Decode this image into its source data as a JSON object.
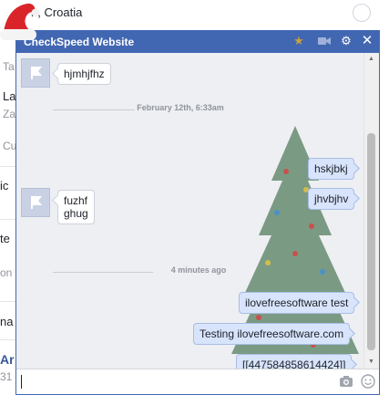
{
  "background": {
    "top_location": "h, Croatia",
    "fragments": [
      "Ta",
      "La",
      "Za",
      "Cu",
      "ic",
      "te",
      "on",
      "na",
      "Ar",
      "31"
    ]
  },
  "chat": {
    "title": "CheckSpeed Website",
    "header_icons": [
      "star-icon",
      "video-call-icon",
      "gear-icon",
      "close-icon"
    ],
    "messages": [
      {
        "direction": "in",
        "text": "hjmhjfhz"
      },
      {
        "type": "divider",
        "text": "February 12th, 6:33am"
      },
      {
        "direction": "out",
        "text": "hskjbkj"
      },
      {
        "direction": "out",
        "text": "jhvbjhv"
      },
      {
        "direction": "in",
        "text": "fuzhf ghug",
        "line1": "fuzhf",
        "line2": "ghug"
      },
      {
        "type": "divider",
        "text": "4 minutes ago"
      },
      {
        "direction": "out",
        "text": "ilovefreesoftware test"
      },
      {
        "direction": "out",
        "text": "Testing ilovefreesoftware.com"
      },
      {
        "direction": "out",
        "text": "[[447584858614424]]"
      }
    ],
    "input": {
      "value": "",
      "icons": [
        "camera-icon",
        "emoji-icon"
      ]
    }
  },
  "colors": {
    "header": "#4267b2",
    "outgoing_bubble": "#d8e4fb",
    "chat_bg": "#edeff2"
  }
}
